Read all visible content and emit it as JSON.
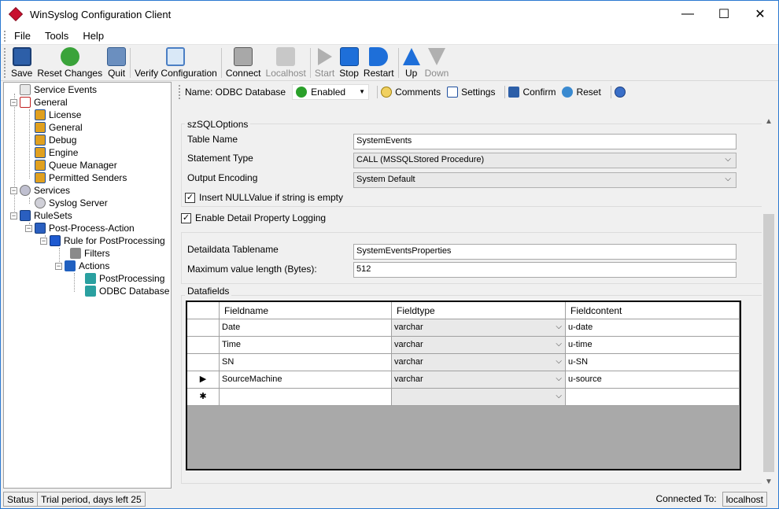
{
  "window": {
    "title": "WinSyslog Configuration Client",
    "minimize": "—",
    "maximize": "☐",
    "close": "✕"
  },
  "menu": [
    "File",
    "Tools",
    "Help"
  ],
  "toolbar": {
    "save": "Save",
    "reset_changes": "Reset Changes",
    "quit": "Quit",
    "verify": "Verify Configuration",
    "connect": "Connect",
    "localhost": "Localhost",
    "start": "Start",
    "stop": "Stop",
    "restart": "Restart",
    "up": "Up",
    "down": "Down"
  },
  "tree": {
    "service_events": "Service Events",
    "general": "General",
    "license": "License",
    "general_sub": "General",
    "debug": "Debug",
    "engine": "Engine",
    "queue_manager": "Queue Manager",
    "permitted_senders": "Permitted Senders",
    "services": "Services",
    "syslog_server": "Syslog Server",
    "rulesets": "RuleSets",
    "post_process": "Post-Process-Action",
    "rule": "Rule for PostProcessing",
    "filters": "Filters",
    "actions": "Actions",
    "postprocessing": "PostProcessing",
    "odbc": "ODBC Database"
  },
  "action_bar": {
    "name": "Name: ODBC Database",
    "enabled": "Enabled",
    "comments": "Comments",
    "settings": "Settings",
    "confirm": "Confirm",
    "reset": "Reset"
  },
  "sql_options": {
    "group_title": "szSQLOptions",
    "table_name_label": "Table Name",
    "table_name": "SystemEvents",
    "statement_type_label": "Statement Type",
    "statement_type": "CALL (MSSQLStored Procedure)",
    "output_encoding_label": "Output Encoding",
    "output_encoding": "System Default",
    "insert_null_label": "Insert NULLValue if string is empty"
  },
  "enable_detail_label": "Enable Detail Property Logging",
  "detail": {
    "tablename_label": "Detaildata Tablename",
    "tablename": "SystemEventsProperties",
    "maxlen_label": "Maximum value length (Bytes):",
    "maxlen": "512"
  },
  "datafields": {
    "group_title": "Datafields",
    "headers": [
      "Fieldname",
      "Fieldtype",
      "Fieldcontent"
    ],
    "rows": [
      {
        "marker": "",
        "name": "Date",
        "type": "varchar",
        "content": "u-date"
      },
      {
        "marker": "",
        "name": "Time",
        "type": "varchar",
        "content": "u-time"
      },
      {
        "marker": "",
        "name": "SN",
        "type": "varchar",
        "content": "u-SN"
      },
      {
        "marker": "▶",
        "name": "SourceMachine",
        "type": "varchar",
        "content": "u-source"
      },
      {
        "marker": "✱",
        "name": "",
        "type": "",
        "content": ""
      }
    ]
  },
  "status": {
    "label": "Status",
    "trial": "Trial period, days left 25",
    "connected_label": "Connected To:",
    "host": "localhost"
  },
  "colors": {
    "accent": "#2b79d0",
    "grid_bg": "#a9a9a9"
  }
}
